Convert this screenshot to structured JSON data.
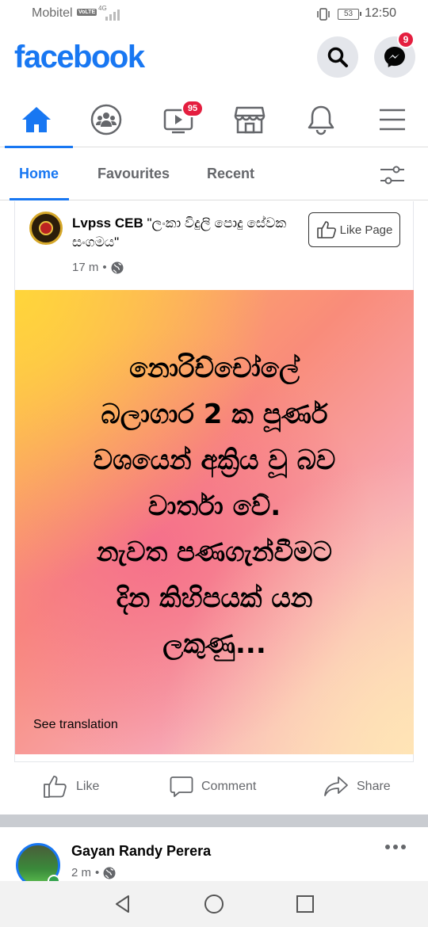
{
  "status_bar": {
    "carrier": "Mobitel",
    "volte": "VoLTE",
    "network": "4G",
    "battery": "53",
    "time": "12:50"
  },
  "header": {
    "logo": "facebook",
    "messenger_badge": "9"
  },
  "nav": {
    "active": "home",
    "video_badge": "95"
  },
  "subnav": {
    "tabs": [
      "Home",
      "Favourites",
      "Recent"
    ],
    "active": "Home"
  },
  "post": {
    "author": "Lvpss CEB",
    "author_quote": "\"ලංකා විදුලි පොදු සේවක සංගමය\"",
    "time": "17 m",
    "like_page": "Like Page",
    "text_lines": [
      "නොරිච්චෝලේ",
      "බලාගාර 2 ක පූර්ණ",
      "වශයෙන් අක්‍රිය වූ බව",
      "වාර්තා වේ.",
      "නැවත පණගැන්වීමට",
      "දින කිහිපයක් යන",
      "ලකුණු..."
    ],
    "see_translation": "See translation"
  },
  "actions": {
    "like": "Like",
    "comment": "Comment",
    "share": "Share"
  },
  "post2": {
    "author": "Gayan Randy Perera",
    "time": "2 m"
  },
  "colors": {
    "brand": "#1877f2",
    "badge": "#e41e3f",
    "secondary_text": "#65676b"
  }
}
